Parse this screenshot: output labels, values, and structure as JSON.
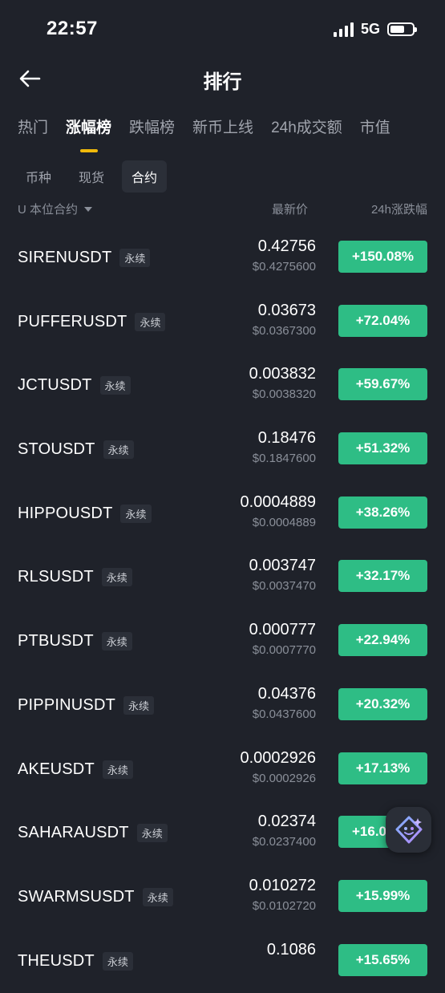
{
  "status_bar": {
    "time": "22:57",
    "network": "5G"
  },
  "header": {
    "title": "排行"
  },
  "tabs": [
    {
      "label": "热门",
      "active": false
    },
    {
      "label": "涨幅榜",
      "active": true
    },
    {
      "label": "跌幅榜",
      "active": false
    },
    {
      "label": "新币上线",
      "active": false
    },
    {
      "label": "24h成交额",
      "active": false
    },
    {
      "label": "市值",
      "active": false
    }
  ],
  "subtabs": [
    {
      "label": "币种",
      "active": false
    },
    {
      "label": "现货",
      "active": false
    },
    {
      "label": "合约",
      "active": true
    }
  ],
  "columns": {
    "filter": "U 本位合约",
    "price": "最新价",
    "change": "24h涨跌幅"
  },
  "rows": [
    {
      "symbol": "SIRENUSDT",
      "tag": "永续",
      "price": "0.42756",
      "usd": "$0.4275600",
      "change": "+150.08%"
    },
    {
      "symbol": "PUFFERUSDT",
      "tag": "永续",
      "price": "0.03673",
      "usd": "$0.0367300",
      "change": "+72.04%"
    },
    {
      "symbol": "JCTUSDT",
      "tag": "永续",
      "price": "0.003832",
      "usd": "$0.0038320",
      "change": "+59.67%"
    },
    {
      "symbol": "STOUSDT",
      "tag": "永续",
      "price": "0.18476",
      "usd": "$0.1847600",
      "change": "+51.32%"
    },
    {
      "symbol": "HIPPOUSDT",
      "tag": "永续",
      "price": "0.0004889",
      "usd": "$0.0004889",
      "change": "+38.26%"
    },
    {
      "symbol": "RLSUSDT",
      "tag": "永续",
      "price": "0.003747",
      "usd": "$0.0037470",
      "change": "+32.17%"
    },
    {
      "symbol": "PTBUSDT",
      "tag": "永续",
      "price": "0.000777",
      "usd": "$0.0007770",
      "change": "+22.94%"
    },
    {
      "symbol": "PIPPINUSDT",
      "tag": "永续",
      "price": "0.04376",
      "usd": "$0.0437600",
      "change": "+20.32%"
    },
    {
      "symbol": "AKEUSDT",
      "tag": "永续",
      "price": "0.0002926",
      "usd": "$0.0002926",
      "change": "+17.13%"
    },
    {
      "symbol": "SAHARAUSDT",
      "tag": "永续",
      "price": "0.02374",
      "usd": "$0.0237400",
      "change": "+16.0"
    },
    {
      "symbol": "SWARMSUSDT",
      "tag": "永续",
      "price": "0.010272",
      "usd": "$0.0102720",
      "change": "+15.99%"
    },
    {
      "symbol": "THEUSDT",
      "tag": "永续",
      "price": "0.1086",
      "usd": "",
      "change": "+15.65%"
    }
  ],
  "colors": {
    "background": "#1f222a",
    "up": "#2ebd85",
    "accent": "#f0b90b"
  },
  "icons": {
    "back": "arrow-left-icon",
    "assistant": "ai-assistant-icon"
  }
}
